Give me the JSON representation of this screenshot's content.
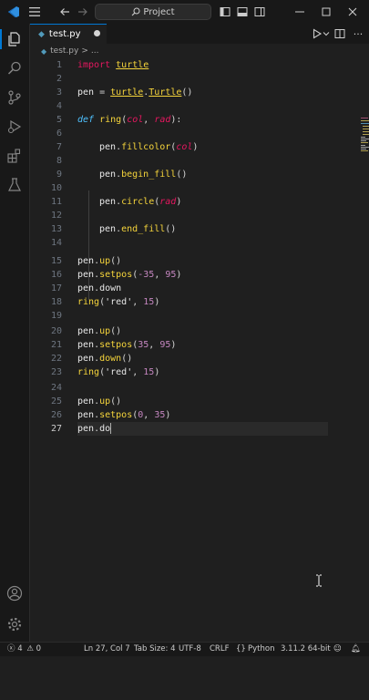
{
  "title_bar": {
    "search_label": "Project",
    "icons": [
      "vscode-logo-icon",
      "menu-icon",
      "back-arrow-icon",
      "forward-arrow-icon",
      "search-icon",
      "toggle-primary-sidebar-icon",
      "toggle-panel-icon",
      "toggle-secondary-sidebar-icon",
      "minimize-icon",
      "maximize-icon",
      "close-icon"
    ]
  },
  "activity_bar": {
    "icons": [
      "explorer-icon",
      "search-icon",
      "source-control-icon",
      "run-debug-icon",
      "extensions-icon",
      "testing-icon",
      "account-icon",
      "manage-gear-icon"
    ]
  },
  "tab": {
    "label": "test.py",
    "modified": true
  },
  "breadcrumb": {
    "file": "test.py",
    "sep": ">",
    "rest": "..."
  },
  "editor": {
    "current_line": 27,
    "lines": [
      {
        "n": "1"
      },
      {
        "n": "2"
      },
      {
        "n": "3"
      },
      {
        "n": "4"
      },
      {
        "n": "5"
      },
      {
        "n": "6"
      },
      {
        "n": "7"
      },
      {
        "n": "8"
      },
      {
        "n": "9"
      },
      {
        "n": "10"
      },
      {
        "n": "11"
      },
      {
        "n": "12"
      },
      {
        "n": "13"
      },
      {
        "n": "14"
      },
      {
        "n": "15"
      },
      {
        "n": "16"
      },
      {
        "n": "17"
      },
      {
        "n": "18"
      },
      {
        "n": "19"
      },
      {
        "n": "20"
      },
      {
        "n": "21"
      },
      {
        "n": "22"
      },
      {
        "n": "23"
      },
      {
        "n": "24"
      },
      {
        "n": "25"
      },
      {
        "n": "26"
      },
      {
        "n": "27"
      }
    ],
    "tokens": {
      "l1_kw": "import",
      "l1_mod": "turtle",
      "l3_var": "pen",
      "l3_eq": " = ",
      "l3_mod": "turtle",
      "l3_dot": ".",
      "l3_cls": "Turtle",
      "l3_p": "()",
      "l5_def": "def",
      "l5_fn": "ring",
      "l5_p1": "(",
      "l5_a1": "col",
      "l5_c": ", ",
      "l5_a2": "rad",
      "l5_p2": "):",
      "l7_var": "pen",
      "l7_dot": ".",
      "l7_fn": "fillcolor",
      "l7_p1": "(",
      "l7_a": "col",
      "l7_p2": ")",
      "l9_var": "pen",
      "l9_dot": ".",
      "l9_fn": "begin_fill",
      "l9_p": "()",
      "l11_var": "pen",
      "l11_dot": ".",
      "l11_fn": "circle",
      "l11_p1": "(",
      "l11_a": "rad",
      "l11_p2": ")",
      "l13_var": "pen",
      "l13_dot": ".",
      "l13_fn": "end_fill",
      "l13_p": "()",
      "l15_var": "pen",
      "l15_dot": ".",
      "l15_fn": "up",
      "l15_p": "()",
      "l16_var": "pen",
      "l16_dot": ".",
      "l16_fn": "setpos",
      "l16_p1": "(",
      "l16_n1": "-35",
      "l16_c": ", ",
      "l16_n2": "95",
      "l16_p2": ")",
      "l17_var": "pen",
      "l17_dot": ".",
      "l17_fn": "down",
      "l18_fn": "ring",
      "l18_p1": "(",
      "l18_s": "'red'",
      "l18_c": ", ",
      "l18_n": "15",
      "l18_p2": ")",
      "l20_var": "pen",
      "l20_dot": ".",
      "l20_fn": "up",
      "l20_p": "()",
      "l21_var": "pen",
      "l21_dot": ".",
      "l21_fn": "setpos",
      "l21_p1": "(",
      "l21_n1": "35",
      "l21_c": ", ",
      "l21_n2": "95",
      "l21_p2": ")",
      "l22_var": "pen",
      "l22_dot": ".",
      "l22_fn": "down",
      "l22_p": "()",
      "l23_fn": "ring",
      "l23_p1": "(",
      "l23_s": "'red'",
      "l23_c": ", ",
      "l23_n": "15",
      "l23_p2": ")",
      "l25_var": "pen",
      "l25_dot": ".",
      "l25_fn": "up",
      "l25_p": "()",
      "l26_var": "pen",
      "l26_dot": ".",
      "l26_fn": "setpos",
      "l26_p1": "(",
      "l26_n1": "0",
      "l26_c": ", ",
      "l26_n2": "35",
      "l26_p2": ")",
      "l27_var": "pen",
      "l27_dot": ".",
      "l27_fn": "do"
    }
  },
  "status_bar": {
    "errors": "4",
    "warnings": "0",
    "position": "Ln 27, Col 7",
    "tab_size": "Tab Size: 4",
    "encoding": "UTF-8",
    "eol": "CRLF",
    "language": "Python",
    "interpreter": "3.11.2 64-bit"
  },
  "colors": {
    "accent": "#0078d4",
    "keyword": "#e5175f",
    "function": "#f5d43b",
    "def_keyword": "#4fc1ff",
    "number": "#c586c0",
    "background": "#1f1f1f"
  }
}
